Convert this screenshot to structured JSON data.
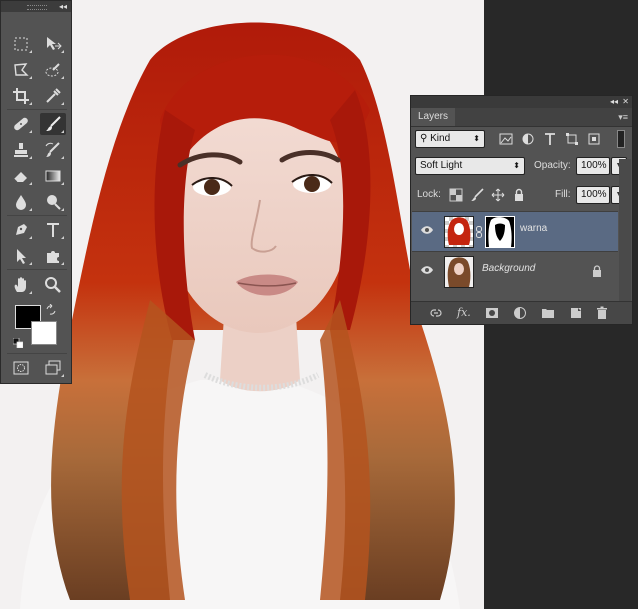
{
  "tools": {
    "collapse_glyph": "◂◂",
    "items": [
      "rect-marquee",
      "move",
      "polygon-lasso",
      "quick-select",
      "crop",
      "eyedropper",
      "spot-heal",
      "brush",
      "clone-stamp",
      "history-brush",
      "eraser",
      "gradient",
      "blur",
      "dodge",
      "pen",
      "type",
      "path-select",
      "custom-shape",
      "hand",
      "zoom"
    ],
    "colors": {
      "foreground": "#000000",
      "background": "#ffffff"
    }
  },
  "layers_panel": {
    "collapse_glyph": "◂◂",
    "close_glyph": "✕",
    "tab_label": "Layers",
    "filter_kind": "Kind",
    "blend_mode": "Soft Light",
    "opacity_label": "Opacity:",
    "opacity_value": "100%",
    "lock_label": "Lock:",
    "fill_label": "Fill:",
    "fill_value": "100%",
    "layers": [
      {
        "name": "warna",
        "selected": true,
        "has_mask": true
      },
      {
        "name": "Background",
        "selected": false,
        "locked": true
      }
    ]
  },
  "canvas": {
    "description_color": "#f2f0f0"
  }
}
